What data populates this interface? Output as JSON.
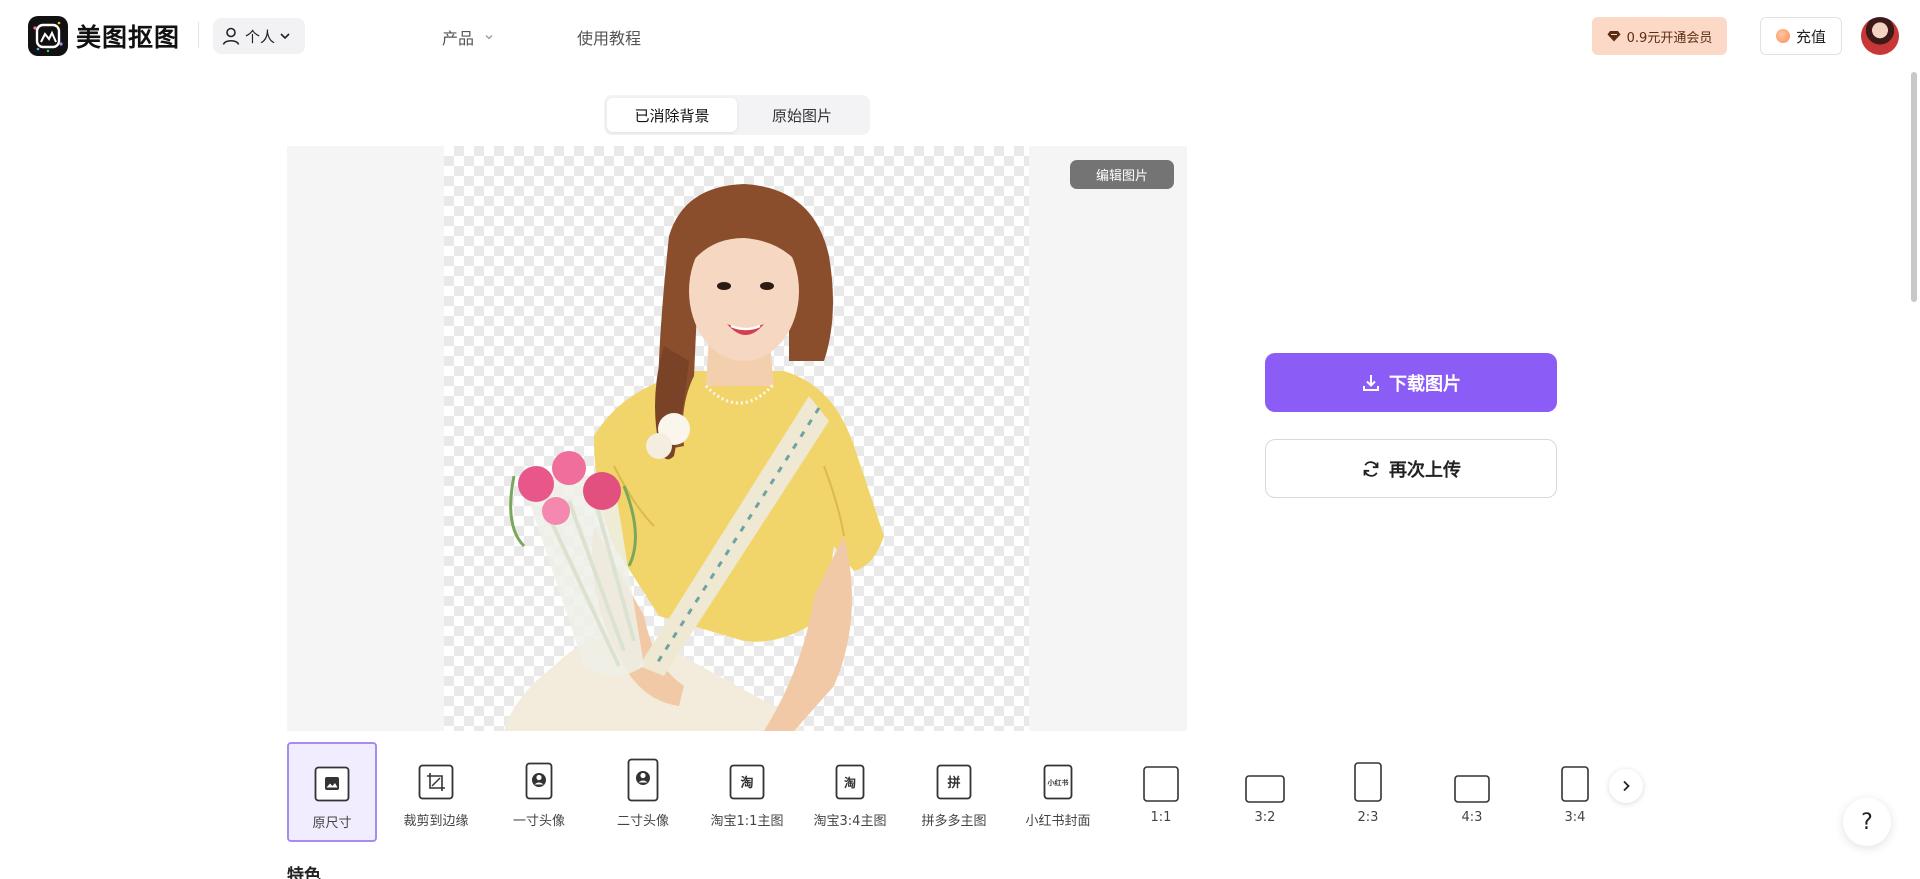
{
  "header": {
    "brand": "美图抠图",
    "account_label": "个人",
    "nav_product": "产品",
    "nav_tutorial": "使用教程",
    "vip_label": "0.9元开通会员",
    "recharge_label": "充值"
  },
  "view_toggle": {
    "removed_bg": "已消除背景",
    "original": "原始图片",
    "active": "已消除背景"
  },
  "preview": {
    "edit_label": "编辑图片"
  },
  "actions": {
    "download_label": "下载图片",
    "reupload_label": "再次上传"
  },
  "size_options": [
    {
      "label": "原尺寸",
      "icon": "image-icon",
      "selected": true
    },
    {
      "label": "裁剪到边缘",
      "icon": "crop-icon"
    },
    {
      "label": "一寸头像",
      "icon": "portrait-icon"
    },
    {
      "label": "二寸头像",
      "icon": "portrait-icon"
    },
    {
      "label": "淘宝1:1主图",
      "icon": "taobao-icon"
    },
    {
      "label": "淘宝3:4主图",
      "icon": "taobao-icon"
    },
    {
      "label": "拼多多主图",
      "icon": "pinduoduo-icon"
    },
    {
      "label": "小红书封面",
      "icon": "xiaohongshu-icon"
    },
    {
      "label": "1:1",
      "icon": "ratio-icon"
    },
    {
      "label": "3:2",
      "icon": "ratio-icon"
    },
    {
      "label": "2:3",
      "icon": "ratio-icon"
    },
    {
      "label": "4:3",
      "icon": "ratio-icon"
    },
    {
      "label": "3:4",
      "icon": "ratio-icon"
    }
  ],
  "icon_text": {
    "taobao": "淘",
    "pinduoduo": "拼",
    "xiaohongshu": "小红书"
  },
  "help_label": "?",
  "section_peek": "特色",
  "colors": {
    "accent": "#8b5cf6",
    "selected_bg": "#f1ecfe",
    "vip_bg": "#fcd9c7"
  }
}
